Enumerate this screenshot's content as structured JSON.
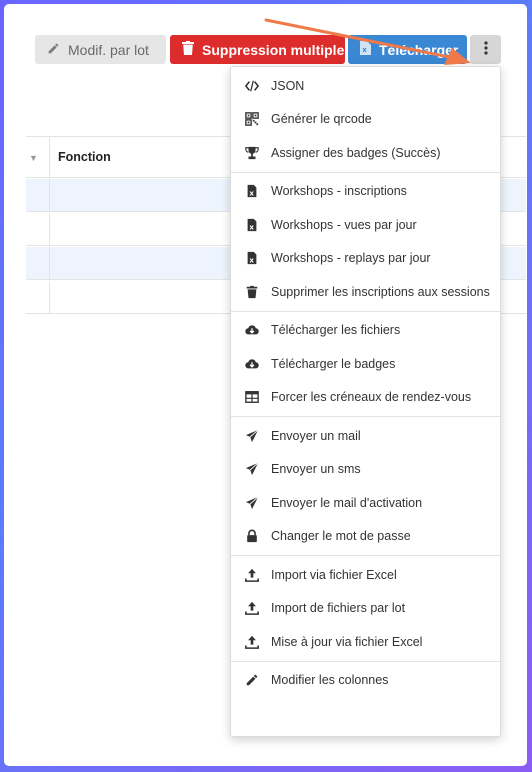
{
  "toolbar": {
    "edit_batch_label": "Modif. par lot",
    "delete_multiple_label": "Suppression multiple",
    "download_label": "Télécharger"
  },
  "grid": {
    "column_header": "Fonction"
  },
  "menu": {
    "groups": [
      {
        "items": [
          {
            "label": "JSON",
            "icon": "code-icon"
          },
          {
            "label": "Générer le qrcode",
            "icon": "qrcode-icon"
          },
          {
            "label": "Assigner des badges (Succès)",
            "icon": "trophy-icon"
          }
        ]
      },
      {
        "items": [
          {
            "label": "Workshops - inscriptions",
            "icon": "excel-file-icon"
          },
          {
            "label": "Workshops - vues par jour",
            "icon": "excel-file-icon"
          },
          {
            "label": "Workshops - replays par jour",
            "icon": "excel-file-icon"
          },
          {
            "label": "Supprimer les inscriptions aux sessions",
            "icon": "trash-icon"
          }
        ]
      },
      {
        "items": [
          {
            "label": "Télécharger les fichiers",
            "icon": "cloud-download-icon"
          },
          {
            "label": "Télécharger le badges",
            "icon": "cloud-download-icon"
          },
          {
            "label": "Forcer les créneaux de rendez-vous",
            "icon": "table-icon"
          }
        ]
      },
      {
        "items": [
          {
            "label": "Envoyer un mail",
            "icon": "paper-plane-icon"
          },
          {
            "label": "Envoyer un sms",
            "icon": "paper-plane-icon"
          },
          {
            "label": "Envoyer le mail d'activation",
            "icon": "paper-plane-icon"
          },
          {
            "label": "Changer le mot de passe",
            "icon": "lock-icon"
          }
        ]
      },
      {
        "items": [
          {
            "label": "Import via fichier Excel",
            "icon": "upload-icon"
          },
          {
            "label": "Import de fichiers par lot",
            "icon": "upload-icon"
          },
          {
            "label": "Mise à jour via fichier Excel",
            "icon": "upload-icon"
          }
        ]
      },
      {
        "items": [
          {
            "label": "Modifier les colonnes",
            "icon": "pencil-icon"
          }
        ]
      }
    ]
  },
  "colors": {
    "delete": "#dc2c2c",
    "download": "#3a87d4",
    "arrow": "#f0794a",
    "row_highlight": "#edf4fd"
  }
}
